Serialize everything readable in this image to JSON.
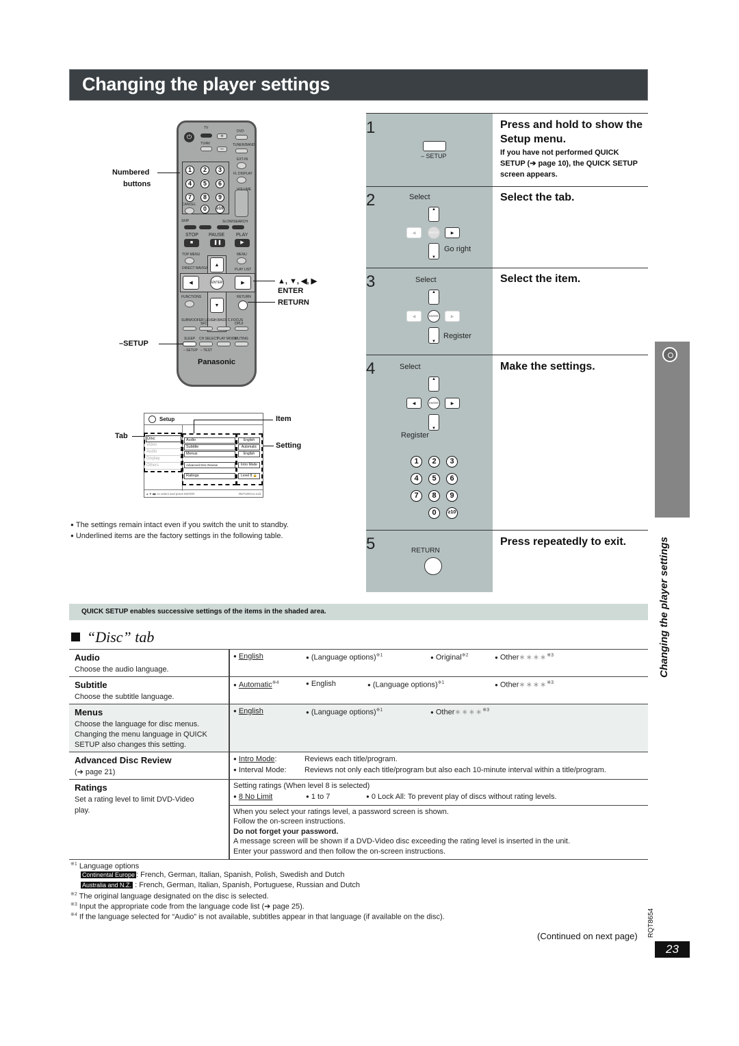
{
  "title": "Changing the player settings",
  "remote": {
    "brand": "Panasonic",
    "labels": {
      "tv": "TV",
      "tvav": "TV/AV",
      "volume": "VOLUME",
      "dvd": "DVD",
      "tuner_band": "TUNER/BAND",
      "ext_in": "EXT-IN",
      "fl_display": "FL DISPLAY",
      "volume2": "VOLUME",
      "cancel": "CANCEL",
      "skip": "SKIP",
      "slow_search": "SLOW/SEARCH",
      "stop": "STOP",
      "pause": "PAUSE",
      "play": "PLAY",
      "top_menu": "TOP MENU",
      "menu": "MENU",
      "direct_navigator": "DIRECT NAVIGATOR",
      "play_list": "PLAY LIST",
      "enter": "ENTER",
      "functions": "FUNCTIONS",
      "return": "RETURN",
      "subwoofer_level": "SUBWOOFER LEVEL",
      "sfc": "SFC",
      "h_bass": "H.BASS C.FOCUS",
      "dplii": "DPLII",
      "sleep": "SLEEP",
      "setup": "– SETUP",
      "ch_select": "CH SELECT",
      "test": "– TEST",
      "play_mode": "PLAY MODE",
      "muting": "MUTING"
    },
    "numbers": [
      "1",
      "2",
      "3",
      "4",
      "5",
      "6",
      "7",
      "8",
      "9",
      "0",
      "≥10"
    ],
    "callouts": {
      "numbered": "Numbered",
      "buttons": "buttons",
      "arrows": "▲, ▼, ◀, ▶",
      "enter": "ENTER",
      "return": "RETURN",
      "setup": "–SETUP"
    }
  },
  "osd": {
    "title": "Setup",
    "tabs": [
      "Disc",
      "Video",
      "Audio",
      "Display",
      "Others"
    ],
    "items": [
      "Audio",
      "Subtitle",
      "Menus",
      "Advanced Disc Review",
      "Ratings"
    ],
    "settings": [
      "English",
      "Automatic",
      "English",
      "Intro Mode",
      "Level 8 🔒"
    ],
    "footer_left": "▲▼◀▶ to select and press ENTER",
    "footer_right": "RETURN to exit",
    "callouts": {
      "tab": "Tab",
      "item": "Item",
      "setting": "Setting"
    }
  },
  "notes": [
    "The settings remain intact even if you switch the unit to standby.",
    "Underlined items are the factory settings in the following table."
  ],
  "steps": [
    {
      "num": "1",
      "title": "Press and hold to show the Setup menu.",
      "sub": "If you have not performed QUICK SETUP (➔ page 10), the QUICK SETUP screen appears.",
      "key_label": "– SETUP"
    },
    {
      "num": "2",
      "title": "Select the tab.",
      "select": "Select",
      "action": "Go right"
    },
    {
      "num": "3",
      "title": "Select the item.",
      "select": "Select",
      "action": "Register"
    },
    {
      "num": "4",
      "title": "Make the settings.",
      "select": "Select",
      "action": "Register",
      "numbers": [
        "1",
        "2",
        "3",
        "4",
        "5",
        "6",
        "7",
        "8",
        "9",
        "0",
        "≥10"
      ]
    },
    {
      "num": "5",
      "title": "Press repeatedly to exit.",
      "key_label": "RETURN"
    }
  ],
  "enter_label": "ENTER",
  "side_tab": "Changing the player settings",
  "quick_setup_note": "QUICK SETUP enables successive settings of the items in the shaded area.",
  "section_title": "“Disc” tab",
  "table": {
    "audio": {
      "name": "Audio",
      "desc": "Choose the audio language.",
      "opts": [
        "English",
        "(Language options)",
        "Original",
        "Other"
      ],
      "sups": [
        "",
        "※1",
        "※2",
        "※3"
      ]
    },
    "subtitle": {
      "name": "Subtitle",
      "desc": "Choose the subtitle language.",
      "opts": [
        "Automatic",
        "English",
        "(Language options)",
        "Other"
      ],
      "sups": [
        "※4",
        "",
        "※1",
        "※3"
      ]
    },
    "menus": {
      "name": "Menus",
      "desc": [
        "Choose the language for disc menus.",
        "Changing the menu language in QUICK",
        "SETUP also changes this setting."
      ],
      "opts": [
        "English",
        "(Language options)",
        "Other"
      ],
      "sups": [
        "",
        "※1",
        "※3"
      ]
    },
    "adr": {
      "name": "Advanced Disc Review",
      "desc": "(➔ page 21)",
      "opts": [
        {
          "label": "Intro Mode",
          "text": "Reviews each title/program."
        },
        {
          "label": "Interval Mode:",
          "text": "Reviews not only each title/program but also each 10-minute interval within a title/program."
        }
      ]
    },
    "ratings": {
      "name": "Ratings",
      "desc": [
        "Set a rating level to limit DVD-Video",
        "play."
      ],
      "intro": "Setting ratings (When level 8 is selected)",
      "opts": [
        "8 No Limit",
        "1 to 7",
        "0 Lock All: To prevent play of discs without rating levels."
      ],
      "info": [
        "When you select your ratings level, a password screen is shown.",
        "Follow the on-screen instructions.",
        "Do not forget your password.",
        "A message screen will be shown if a DVD-Video disc exceeding the rating level is inserted in the unit.",
        "Enter your password and then follow the on-screen instructions."
      ]
    },
    "stars": "∗∗∗∗"
  },
  "footnotes": {
    "n1_mark": "※1",
    "n1": "Language options",
    "region1": "Continental Europe",
    "region1_text": ": French, German, Italian, Spanish, Polish, Swedish and Dutch",
    "region2": "Australia and N.Z.",
    "region2_text": " : French, German, Italian, Spanish, Portuguese, Russian and Dutch",
    "n2_mark": "※2",
    "n2": "The original language designated on the disc is selected.",
    "n3_mark": "※3",
    "n3": "Input the appropriate code from the language code list (➔ page 25).",
    "n4_mark": "※4",
    "n4": "If the language selected for “Audio” is not available, subtitles appear in that language (if available on the disc)."
  },
  "continued": "(Continued on next page)",
  "doc_code": "RQT8654",
  "page_number": "23"
}
